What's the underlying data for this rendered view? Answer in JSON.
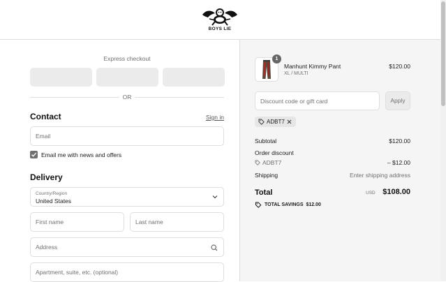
{
  "brand": {
    "name": "BOYS LIE"
  },
  "express": {
    "title": "Express checkout",
    "divider": "OR"
  },
  "contact": {
    "title": "Contact",
    "sign_in": "Sign in",
    "email_placeholder": "Email",
    "newsletter_label": "Email me with news and offers",
    "newsletter_checked": true
  },
  "delivery": {
    "title": "Delivery",
    "country_label": "Country/Region",
    "country_value": "United States",
    "first_name_placeholder": "First name",
    "last_name_placeholder": "Last name",
    "address_placeholder": "Address",
    "apartment_placeholder": "Apartment, suite, etc. (optional)"
  },
  "order": {
    "item": {
      "quantity": "1",
      "name": "Manhunt Kimmy Pant",
      "variant": "XL / MULTI",
      "price": "$120.00"
    },
    "discount_placeholder": "Discount code or gift card",
    "apply_label": "Apply",
    "applied_code": "ADBT7",
    "subtotal_label": "Subtotal",
    "subtotal_value": "$120.00",
    "order_discount_label": "Order discount",
    "order_discount_code": "ADBT7",
    "order_discount_value": "– $12.00",
    "shipping_label": "Shipping",
    "shipping_value": "Enter shipping address",
    "total_label": "Total",
    "total_currency": "USD",
    "total_value": "$108.00",
    "savings_label": "TOTAL SAVINGS",
    "savings_value": "$12.00"
  },
  "colors": {
    "accent": "#707070",
    "panel": "#f5f5f5",
    "border": "#dedede"
  }
}
